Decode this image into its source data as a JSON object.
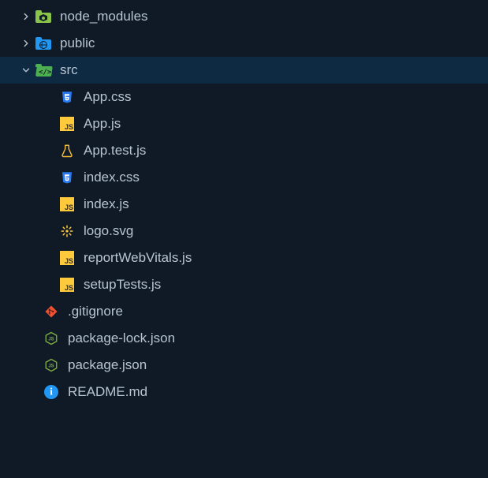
{
  "tree": {
    "items": [
      {
        "id": "node_modules",
        "label": "node_modules",
        "type": "folder",
        "icon": "folder-node-modules",
        "depth": 0,
        "expanded": false,
        "selected": false
      },
      {
        "id": "public",
        "label": "public",
        "type": "folder",
        "icon": "folder-public",
        "depth": 0,
        "expanded": false,
        "selected": false
      },
      {
        "id": "src",
        "label": "src",
        "type": "folder",
        "icon": "folder-src",
        "depth": 0,
        "expanded": true,
        "selected": true
      },
      {
        "id": "app-css",
        "label": "App.css",
        "type": "file",
        "icon": "css-icon",
        "depth": 1,
        "selected": false
      },
      {
        "id": "app-js",
        "label": "App.js",
        "type": "file",
        "icon": "js-icon",
        "depth": 1,
        "selected": false
      },
      {
        "id": "app-test-js",
        "label": "App.test.js",
        "type": "file",
        "icon": "test-icon",
        "depth": 1,
        "selected": false
      },
      {
        "id": "index-css",
        "label": "index.css",
        "type": "file",
        "icon": "css-icon",
        "depth": 1,
        "selected": false
      },
      {
        "id": "index-js",
        "label": "index.js",
        "type": "file",
        "icon": "js-icon",
        "depth": 1,
        "selected": false
      },
      {
        "id": "logo-svg",
        "label": "logo.svg",
        "type": "file",
        "icon": "svg-icon",
        "depth": 1,
        "selected": false
      },
      {
        "id": "report-web-vitals",
        "label": "reportWebVitals.js",
        "type": "file",
        "icon": "js-icon",
        "depth": 1,
        "selected": false
      },
      {
        "id": "setup-tests",
        "label": "setupTests.js",
        "type": "file",
        "icon": "js-icon",
        "depth": 1,
        "selected": false
      },
      {
        "id": "gitignore",
        "label": ".gitignore",
        "type": "file",
        "icon": "git-icon",
        "depth": 0,
        "selected": false
      },
      {
        "id": "package-lock",
        "label": "package-lock.json",
        "type": "file",
        "icon": "nodejs-icon",
        "depth": 0,
        "selected": false
      },
      {
        "id": "package-json",
        "label": "package.json",
        "type": "file",
        "icon": "nodejs-icon",
        "depth": 0,
        "selected": false
      },
      {
        "id": "readme",
        "label": "README.md",
        "type": "file",
        "icon": "info-icon",
        "depth": 0,
        "selected": false
      }
    ]
  },
  "colors": {
    "background": "#0f1a26",
    "selectedRow": "#0d2a42",
    "text": "#b8c5d1"
  }
}
